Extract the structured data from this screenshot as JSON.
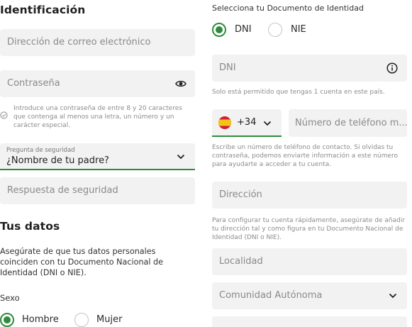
{
  "left": {
    "section_title": "Identificación",
    "email_placeholder": "Dirección de correo electrónico",
    "password_placeholder": "Contraseña",
    "password_hint": "Introduce una contraseña de entre 8 y 20 caracteres que contenga al menos una letra, un número y un carácter especial.",
    "security_question_label": "Pregunta de seguridad",
    "security_question_value": "¿Nombre de tu padre?",
    "security_answer_placeholder": "Respuesta de seguridad",
    "data_title": "Tus datos",
    "data_description": "Asegúrate de que tus datos personales coinciden con tu Documento Nacional de Identidad (DNI o NIE).",
    "sex_label": "Sexo",
    "sex_options": [
      "Hombre",
      "Mujer"
    ],
    "sex_selected": "Hombre"
  },
  "right": {
    "document_label": "Selecciona tu Documento de Identidad",
    "document_options": [
      "DNI",
      "NIE"
    ],
    "document_selected": "DNI",
    "dni_placeholder": "DNI",
    "dni_hint": "Solo está permitido que tengas 1 cuenta en este país.",
    "phone_prefix": "+34",
    "phone_placeholder": "Número de teléfono m...",
    "phone_hint": "Escribe un número de teléfono de contacto. Si olvidas tu contraseña, podemos enviarte información a este número para ayudarte a acceder a tu cuenta.",
    "address_placeholder": "Dirección",
    "address_hint": "Para configurar tu cuenta rápidamente, asegúrate de añadir tu dirección tal y como figura en tu Documento Nacional de Identidad (DNI o NIE).",
    "locality_placeholder": "Localidad",
    "region_placeholder": "Comunidad Autónoma"
  },
  "colors": {
    "accent": "#2e8b3e",
    "field_bg": "#f2f2f2",
    "hint_text": "#8c8c8c"
  },
  "icons": [
    "eye-icon",
    "check-circle-icon",
    "chevron-down-icon",
    "info-icon",
    "spain-flag-icon"
  ]
}
